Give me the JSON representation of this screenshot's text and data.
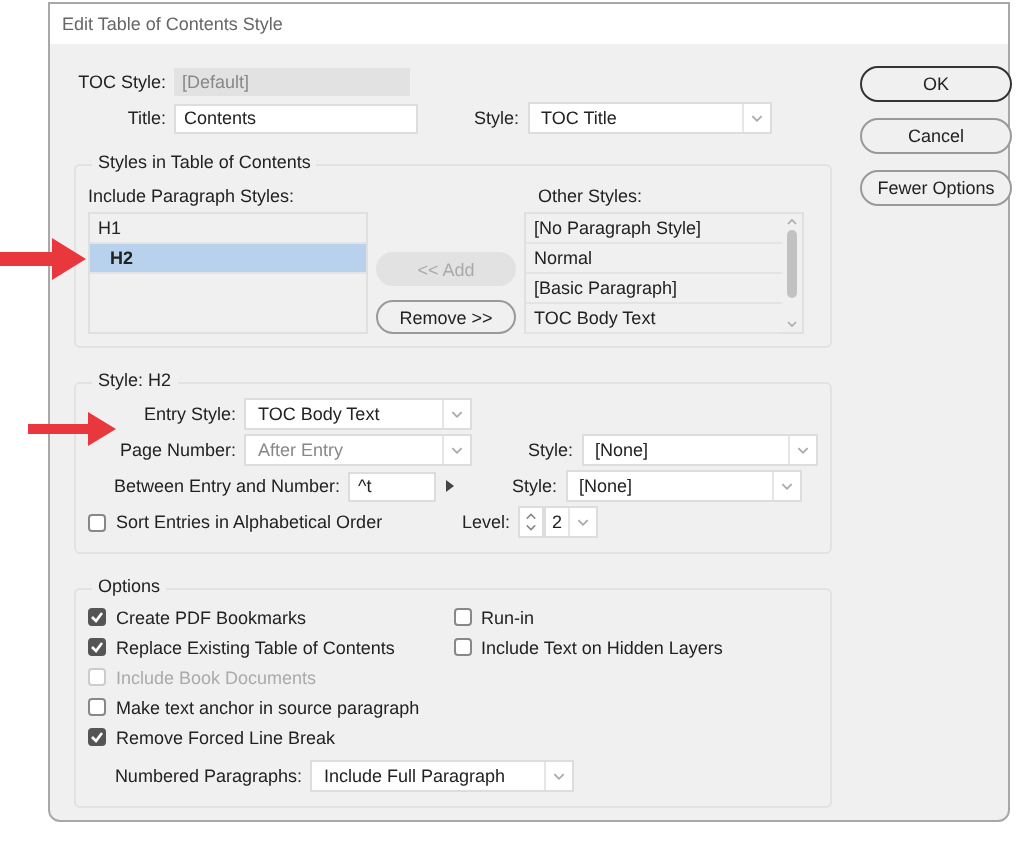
{
  "window": {
    "title": "Edit Table of Contents Style"
  },
  "toc_style": {
    "label": "TOC Style:",
    "value": "[Default]"
  },
  "title_field": {
    "label": "Title:",
    "value": "Contents"
  },
  "title_style": {
    "label": "Style:",
    "value": "TOC Title"
  },
  "buttons": [
    {
      "label": "OK",
      "default": true
    },
    {
      "label": "Cancel",
      "default": false
    },
    {
      "label": "Fewer Options",
      "default": false
    }
  ],
  "styles_group": {
    "legend": "Styles in Table of Contents",
    "include_label": "Include Paragraph Styles:",
    "include_items": [
      {
        "label": "H1",
        "selected": false,
        "children": [
          {
            "label": "H2",
            "selected": true
          }
        ]
      }
    ],
    "add_button": {
      "label": "<< Add",
      "disabled": true
    },
    "remove_button": {
      "label": "Remove >>",
      "disabled": false
    },
    "other_label": "Other Styles:",
    "other_items": [
      {
        "label": "[No Paragraph Style]",
        "selected": false
      },
      {
        "label": "Normal",
        "selected": false
      },
      {
        "label": "[Basic Paragraph]",
        "selected": false
      },
      {
        "label": "TOC Body Text",
        "selected": false
      }
    ]
  },
  "style_group": {
    "legend": "Style: H2",
    "entry_style": {
      "label": "Entry Style:",
      "value": "TOC Body Text"
    },
    "page_number": {
      "label": "Page Number:",
      "value": "After Entry",
      "disabled": true
    },
    "page_number_style": {
      "label": "Style:",
      "value": "[None]"
    },
    "between": {
      "label": "Between Entry and Number:",
      "value": "^t"
    },
    "between_style": {
      "label": "Style:",
      "value": "[None]"
    },
    "sort": {
      "label": "Sort Entries in Alphabetical Order",
      "checked": false
    },
    "level": {
      "label": "Level:",
      "value": "2"
    }
  },
  "options": {
    "legend": "Options",
    "left": [
      {
        "label": "Create PDF Bookmarks",
        "checked": true,
        "disabled": false
      },
      {
        "label": "Replace Existing Table of Contents",
        "checked": true,
        "disabled": false
      },
      {
        "label": "Include Book Documents",
        "checked": false,
        "disabled": true
      },
      {
        "label": "Make text anchor in source paragraph",
        "checked": false,
        "disabled": false
      },
      {
        "label": "Remove Forced Line Break",
        "checked": true,
        "disabled": false
      }
    ],
    "right": [
      {
        "label": "Run-in",
        "checked": false,
        "disabled": false
      },
      {
        "label": "Include Text on Hidden Layers",
        "checked": false,
        "disabled": false
      }
    ],
    "numbered": {
      "label": "Numbered Paragraphs:",
      "value": "Include Full Paragraph"
    }
  }
}
